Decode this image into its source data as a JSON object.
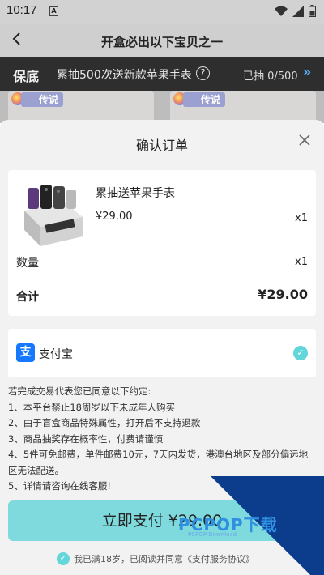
{
  "status_bar": {
    "time": "10:17",
    "a_badge": "A"
  },
  "header": {
    "title": "开盒必出以下宝贝之一",
    "back_icon": "chevron-left-icon"
  },
  "banner": {
    "tag": "保底",
    "promo": "累抽500次送新款苹果手表",
    "help": "?",
    "progress": "已抽 0/500",
    "more": "»"
  },
  "background_cards": [
    {
      "legend": "传说"
    },
    {
      "legend": "传说"
    }
  ],
  "sheet": {
    "title": "确认订单",
    "close": "×",
    "product": {
      "name": "累抽送苹果手表",
      "price": "¥29.00",
      "qty": "x1",
      "thumb_caption": "累抽送苹果手表"
    },
    "quantity": {
      "label": "数量",
      "value": "x1"
    },
    "total": {
      "label": "合计",
      "value": "¥29.00"
    },
    "payment": {
      "icon": "支",
      "name": "支付宝",
      "selected": true
    },
    "terms": [
      "若完成交易代表您已同意以下约定:",
      "1、本平台禁止18周岁以下未成年人购买",
      "2、由于盲盒商品特殊属性，打开后不支持退款",
      "3、商品抽奖存在概率性，付费请谨慎",
      "4、5件可免邮费，单件邮费10元，7天内发货，港澳台地区及部分偏远地区无法配送。",
      "5、详情请咨询在线客服!"
    ],
    "pay_button": "立即支付 ¥29.00",
    "agree": "我已满18岁，已阅读并同意《支付服务协议》"
  },
  "watermark": {
    "text": "PCPOP下载",
    "sub": "PCPOP Download"
  },
  "colors": {
    "accent": "#7fdadd",
    "check": "#62d6d9",
    "alipay": "#1677ff",
    "banner_bg": "#2e2e2e"
  }
}
